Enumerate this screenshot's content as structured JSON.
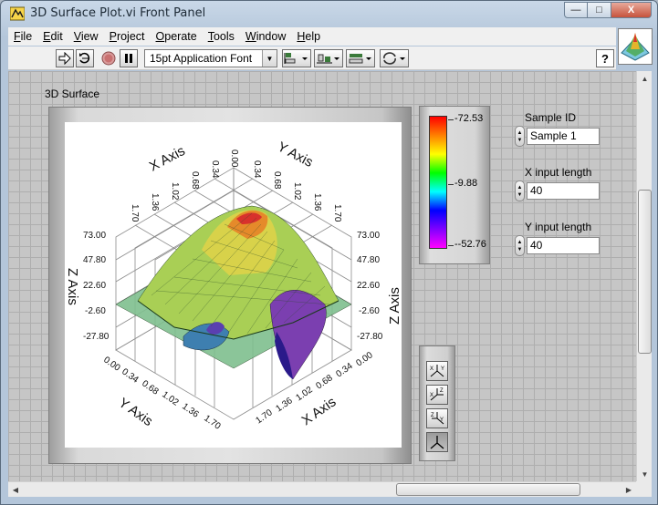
{
  "window": {
    "title": "3D Surface Plot.vi Front Panel"
  },
  "window_controls": {
    "minimize": "—",
    "maximize": "□",
    "close": "X"
  },
  "menu": [
    {
      "key": "F",
      "rest": "ile"
    },
    {
      "key": "E",
      "rest": "dit"
    },
    {
      "key": "V",
      "rest": "iew"
    },
    {
      "key": "P",
      "rest": "roject"
    },
    {
      "key": "O",
      "rest": "perate"
    },
    {
      "key": "T",
      "rest": "ools"
    },
    {
      "key": "W",
      "rest": "indow"
    },
    {
      "key": "H",
      "rest": "elp"
    }
  ],
  "toolbar": {
    "font": "15pt Application Font",
    "help": "?"
  },
  "graph": {
    "label": "3D Surface",
    "x_axis_title": "X Axis",
    "y_axis_title": "Y Axis",
    "z_axis_title": "Z Axis",
    "xy_ticks": [
      "0.00",
      "0.34",
      "0.68",
      "1.02",
      "1.36",
      "1.70"
    ],
    "z_ticks": [
      "73.00",
      "47.80",
      "22.60",
      "-2.60",
      "-27.80"
    ]
  },
  "colorbar": {
    "max": "-72.53",
    "mid": "-9.88",
    "min": "--52.76",
    "colors": [
      "#ff0000",
      "#ff8000",
      "#ffff00",
      "#00ff00",
      "#00ffff",
      "#0000ff",
      "#8000ff",
      "#ff00ff"
    ]
  },
  "controls": {
    "sample_id": {
      "label": "Sample ID",
      "value": "Sample 1"
    },
    "x_input_length": {
      "label": "X input length",
      "value": "40"
    },
    "y_input_length": {
      "label": "Y input length",
      "value": "40"
    }
  },
  "palette": [
    "rotate-xy",
    "rotate-xz",
    "rotate-yz",
    "free-rotate"
  ]
}
